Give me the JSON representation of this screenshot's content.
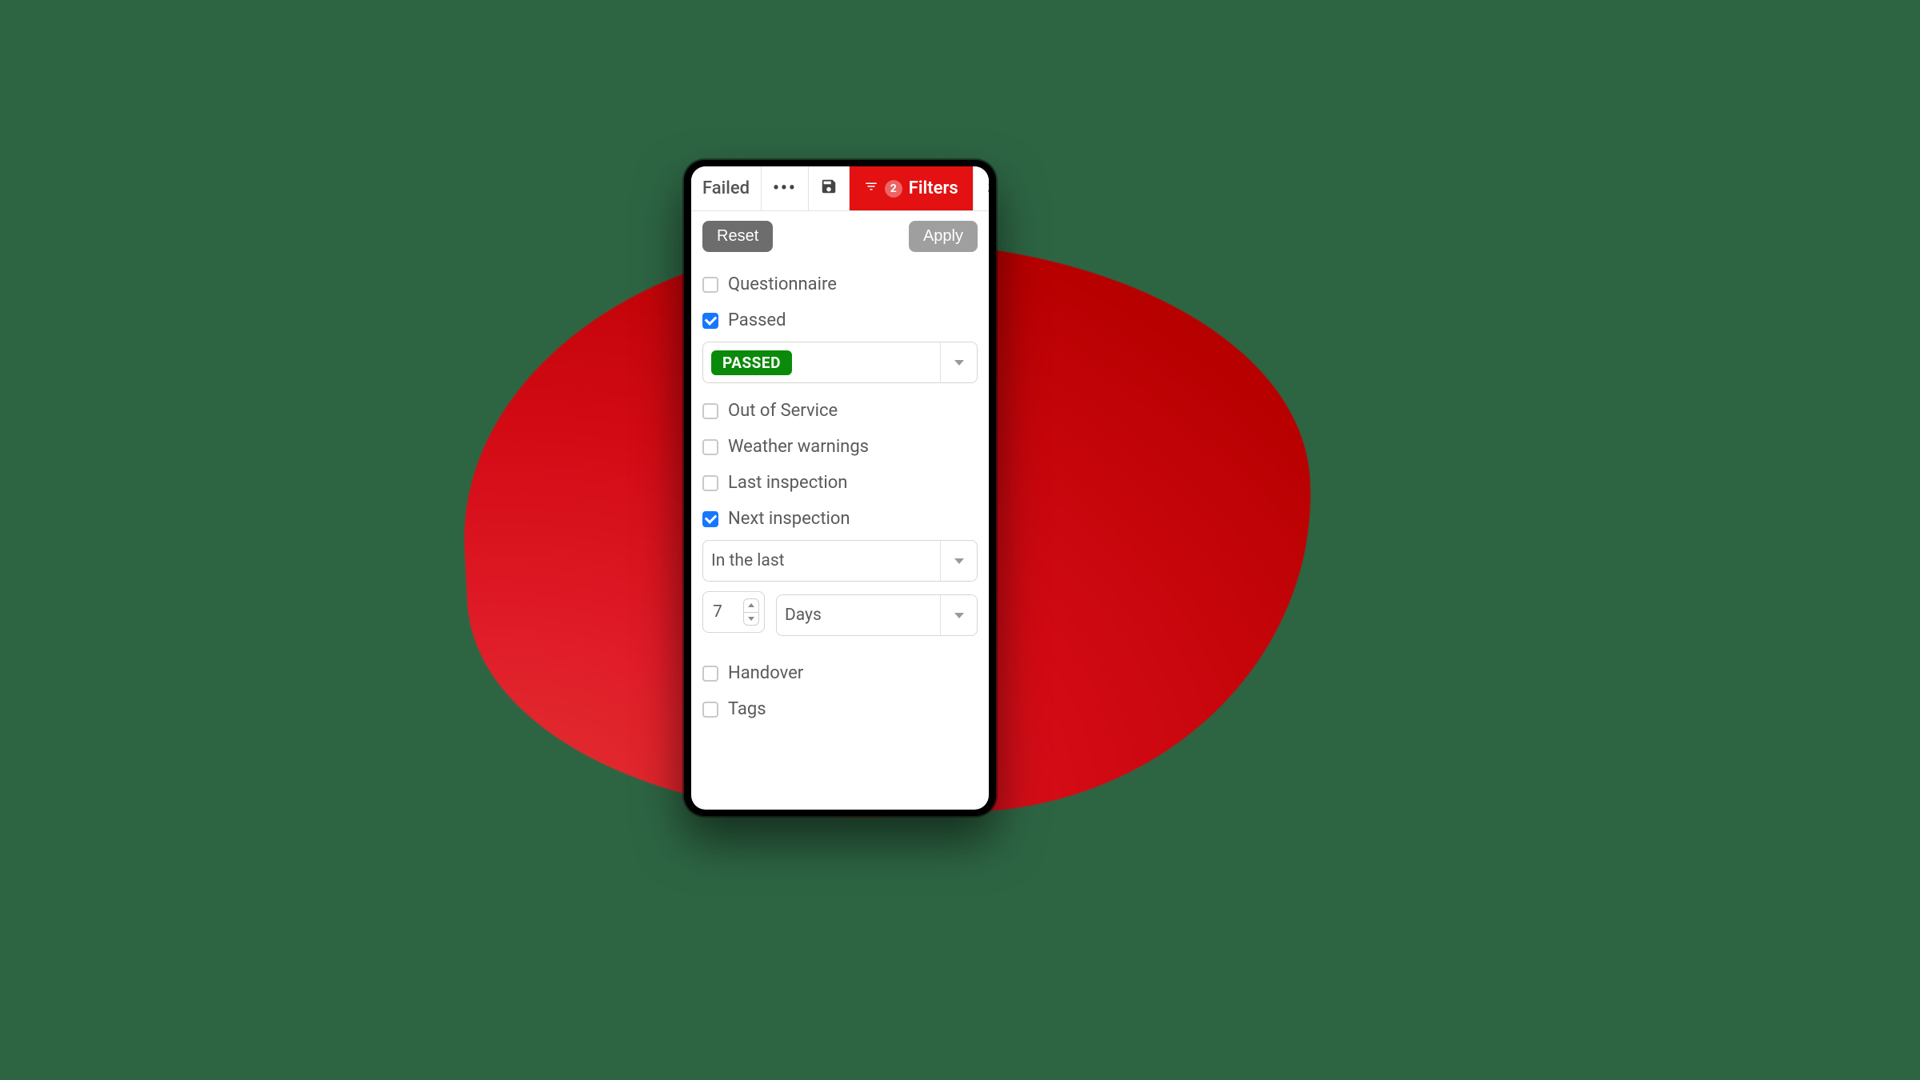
{
  "toolbar": {
    "failed_label": "Failed",
    "filters_label": "Filters",
    "filter_count": "2"
  },
  "panel": {
    "reset_label": "Reset",
    "apply_label": "Apply"
  },
  "filters": {
    "questionnaire": {
      "label": "Questionnaire",
      "checked": false
    },
    "passed": {
      "label": "Passed",
      "checked": true,
      "selected_value": "PASSED"
    },
    "out_of_service": {
      "label": "Out of Service",
      "checked": false
    },
    "weather_warnings": {
      "label": "Weather warnings",
      "checked": false
    },
    "last_inspection": {
      "label": "Last inspection",
      "checked": false
    },
    "next_inspection": {
      "label": "Next inspection",
      "checked": true,
      "range_mode": "In the last",
      "amount": "7",
      "unit": "Days"
    },
    "handover": {
      "label": "Handover",
      "checked": false
    },
    "tags": {
      "label": "Tags",
      "checked": false
    }
  },
  "colors": {
    "accent_red": "#e31111",
    "accent_blue": "#1677ff",
    "accent_green": "#0a8a0a"
  }
}
